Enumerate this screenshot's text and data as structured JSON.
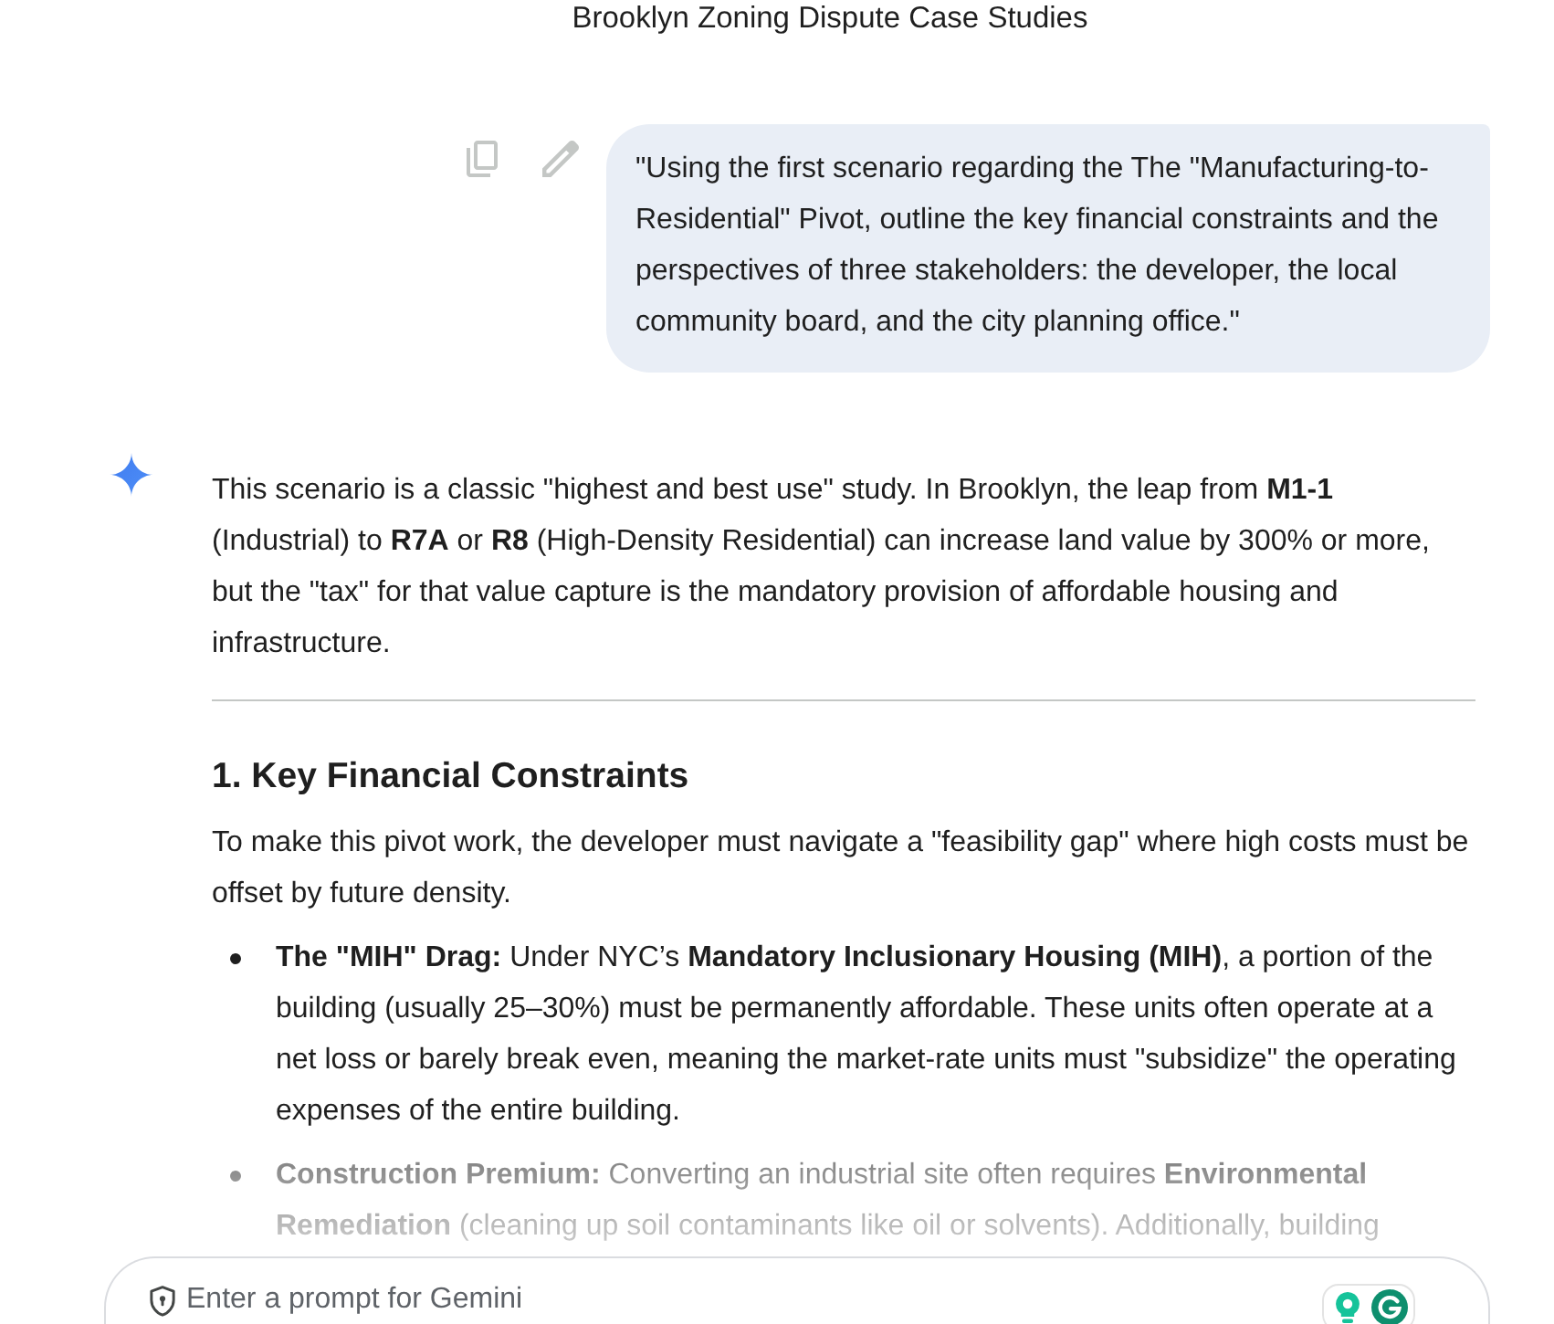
{
  "header": {
    "title": "Brooklyn Zoning Dispute Case Studies"
  },
  "user_message": {
    "text": "\"Using the first scenario regarding the The \"Manufacturing-to-Residential\" Pivot, outline the key financial constraints and the perspectives of three stakeholders: the developer, the local community board, and the city planning office.\""
  },
  "response": {
    "intro": "This scenario is a classic \"highest and best use\" study. In Brooklyn, the leap from **M1-1** (Industrial) to **R7A** or **R8** (High-Density Residential) can increase land value by 300% or more, but the \"tax\" for that value capture is the mandatory provision of affordable housing and infrastructure.",
    "section": {
      "heading": "1. Key Financial Constraints",
      "paragraph": "To make this pivot work, the developer must navigate a \"feasibility gap\" where high costs must be offset by future density.",
      "bullets": [
        {
          "text": "**The \"MIH\" Drag:** Under NYC’s **Mandatory Inclusionary Housing (MIH)**, a portion of the building (usually 25–30%) must be permanently affordable. These units often operate at a net loss or barely break even, meaning the market-rate units must \"subsidize\" the operating expenses of the entire building."
        },
        {
          "text": "**Construction Premium:** Converting an industrial site often requires **Environmental Remediation** (cleaning up soil contaminants like oil or solvents). Additionally, building"
        }
      ]
    }
  },
  "prompt_bar": {
    "placeholder": "Enter a prompt for Gemini"
  }
}
